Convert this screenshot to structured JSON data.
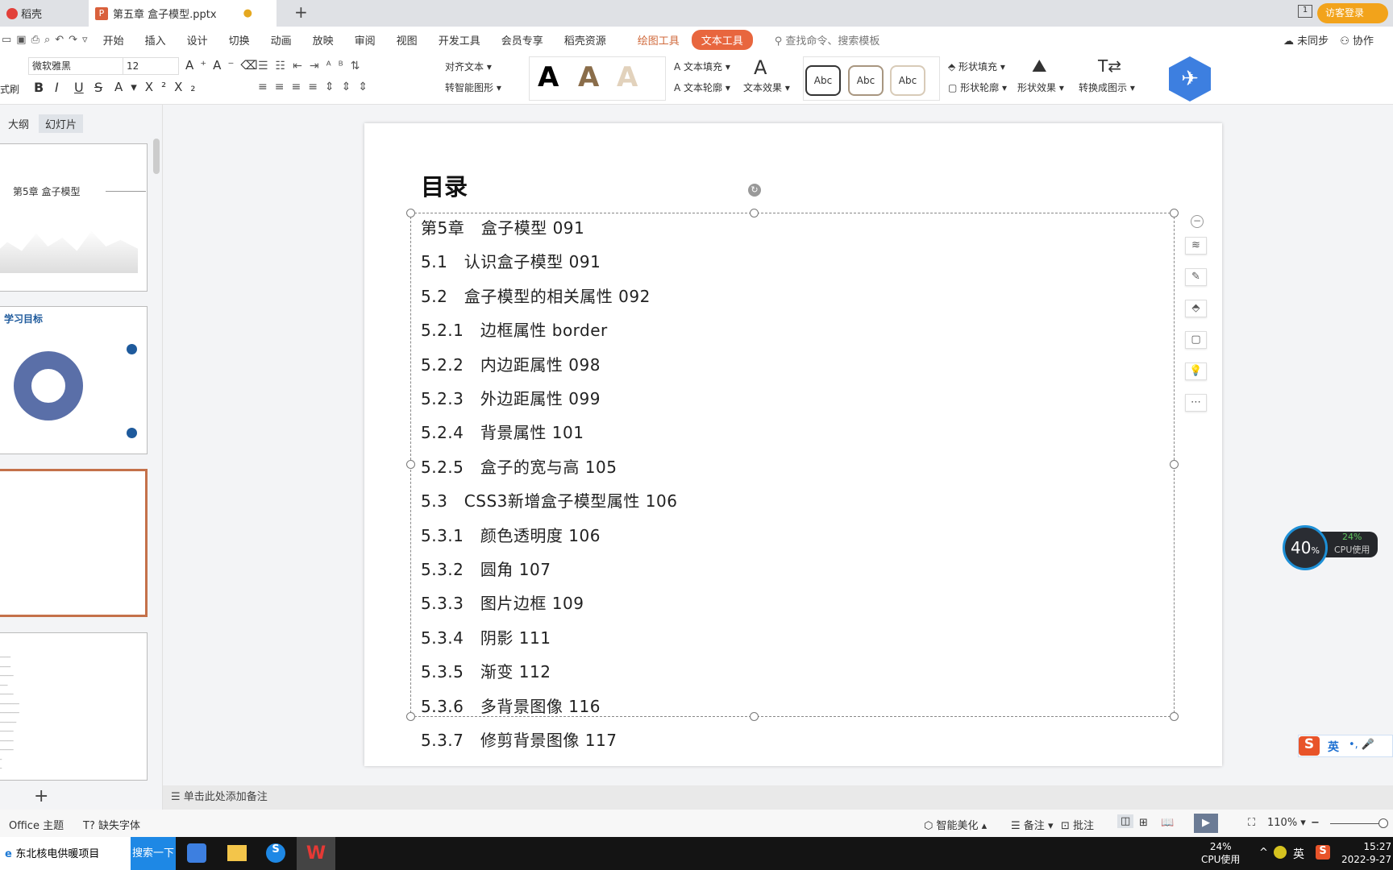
{
  "tabs": [
    {
      "label": "稻壳"
    },
    {
      "label": "第五章 盒子模型.pptx",
      "modified": true
    }
  ],
  "login_label": "访客登录",
  "menu": {
    "items": [
      "开始",
      "插入",
      "设计",
      "切换",
      "动画",
      "放映",
      "审阅",
      "视图",
      "开发工具",
      "会员专享",
      "稻壳资源"
    ],
    "draw_tool": "绘图工具",
    "text_tool": "文本工具",
    "search_placeholder": "查找命令、搜索模板",
    "sync": "未同步",
    "collab": "协作"
  },
  "ribbon": {
    "format_painter": "式刷",
    "font": "微软雅黑",
    "size": "12",
    "align_text": "对齐文本",
    "smart_shape": "转智能图形",
    "text_fill": "文本填充",
    "text_outline": "文本轮廓",
    "text_effect": "文本效果",
    "style_sample": "Abc",
    "shape_fill": "形状填充",
    "shape_outline": "形状轮廓",
    "shape_effect": "形状效果",
    "convert": "转换成图示",
    "bold": "B",
    "italic": "I",
    "underline": "U",
    "strike": "S"
  },
  "left_panel": {
    "tabs": [
      "大纲",
      "幻灯片"
    ],
    "active_tab": "幻灯片",
    "thumb1_title": "第5章  盒子模型",
    "thumb2_title": "学习目标",
    "active_slide": 3
  },
  "slide": {
    "title": "目录",
    "items": [
      "第5章　盒子模型 091",
      "5.1　认识盒子模型 091",
      "5.2　盒子模型的相关属性 092",
      "5.2.1　边框属性 border",
      "5.2.2　内边距属性 098",
      "5.2.3　外边距属性 099",
      "5.2.4　背景属性 101",
      "5.2.5　盒子的宽与高 105",
      "5.3　CSS3新增盒子模型属性 106",
      "5.3.1　颜色透明度 106",
      "5.3.2　圆角 107",
      "5.3.3　图片边框 109",
      "5.3.4　阴影 111",
      "5.3.5　渐变 112",
      "5.3.6　多背景图像 116",
      "5.3.7　修剪背景图像 117"
    ]
  },
  "cpu_widget": {
    "gauge": "40",
    "gauge_unit": "%",
    "cpu": "24%",
    "label": "CPU使用"
  },
  "notes_placeholder": "单击此处添加备注",
  "status": {
    "theme": "Office 主题",
    "missing_font": "缺失字体",
    "beautify": "智能美化",
    "notes": "备注",
    "comment": "批注",
    "zoom": "110%"
  },
  "taskbar": {
    "search_text": "东北核电供暖项目",
    "search_button": "搜索一下",
    "cpu": "24%",
    "cpu_label": "CPU使用",
    "ime": "英",
    "time": "15:27",
    "date": "2022-9-27"
  },
  "colors": {
    "accent": "#e8663e",
    "active_slide_border": "#c4714a",
    "login": "#f2a31b"
  }
}
